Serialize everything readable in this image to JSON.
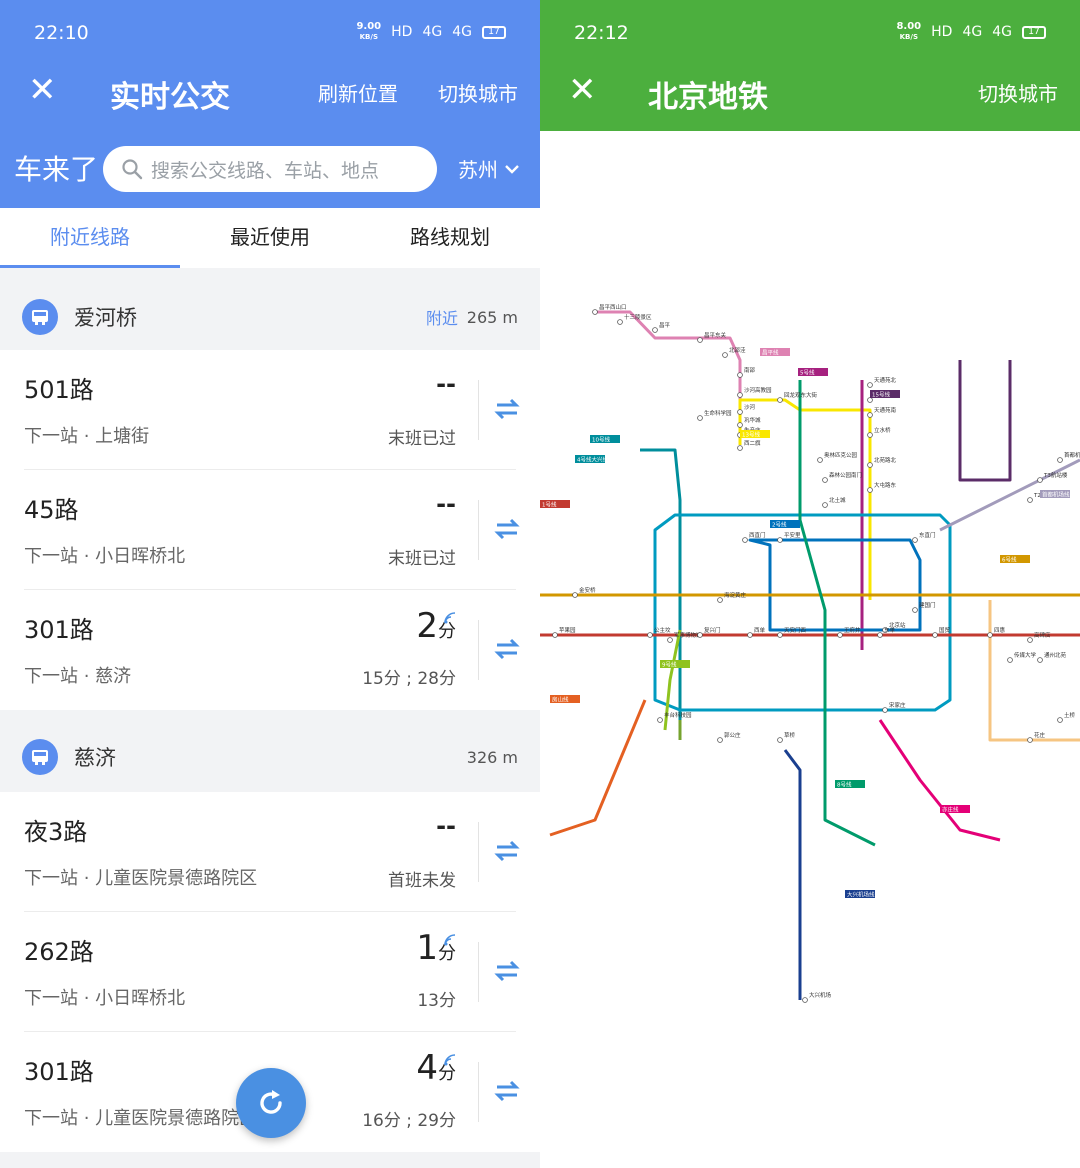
{
  "left": {
    "status": {
      "time": "22:10",
      "speed": "9.00",
      "speed_unit": "KB/S",
      "hd": "HD",
      "net1": "4G",
      "net2": "4G",
      "battery": "17"
    },
    "header": {
      "close_glyph": "✕",
      "title": "实时公交",
      "refresh_label": "刷新位置",
      "switch_city_label": "切换城市",
      "brand": "车来了",
      "search_placeholder": "搜索公交线路、车站、地点",
      "city": "苏州"
    },
    "tabs": [
      {
        "label": "附近线路"
      },
      {
        "label": "最近使用"
      },
      {
        "label": "路线规划"
      }
    ],
    "stops": [
      {
        "name": "爱河桥",
        "near": "附近",
        "distance": "265 m",
        "routes": [
          {
            "line": "501路",
            "next": "下一站 · 上塘街",
            "eta": "--",
            "sub": "末班已过"
          },
          {
            "line": "45路",
            "next": "下一站 · 小日晖桥北",
            "eta": "--",
            "sub": "末班已过"
          },
          {
            "line": "301路",
            "next": "下一站 · 慈济",
            "eta_num": "2",
            "eta_unit": "分",
            "sub": "15分 ; 28分"
          }
        ]
      },
      {
        "name": "慈济",
        "distance": "326 m",
        "routes": [
          {
            "line": "夜3路",
            "next": "下一站 · 儿童医院景德路院区",
            "eta": "--",
            "sub": "首班未发"
          },
          {
            "line": "262路",
            "next": "下一站 · 小日晖桥北",
            "eta_num": "1",
            "eta_unit": "分",
            "sub": "13分"
          },
          {
            "line": "301路",
            "next": "下一站 · 儿童医院景德路院区",
            "eta_num": "4",
            "eta_unit": "分",
            "sub": "16分 ; 29分"
          }
        ]
      }
    ]
  },
  "right": {
    "status": {
      "time": "22:12",
      "speed": "8.00",
      "speed_unit": "KB/S",
      "hd": "HD",
      "net1": "4G",
      "net2": "4G",
      "battery": "17"
    },
    "header": {
      "close_glyph": "✕",
      "title": "北京地铁",
      "switch_city_label": "切换城市"
    },
    "map": {
      "station_labels": [
        "昌平西山口",
        "十三陵景区",
        "昌平",
        "昌平东关",
        "北邵洼",
        "南邵",
        "沙河高教园",
        "沙河",
        "巩华城",
        "朱辛庄",
        "生命科学园",
        "西二旗",
        "回龙观东大街",
        "天通苑北",
        "天通苑",
        "天通苑南",
        "立水桥",
        "北苑路北",
        "大屯路东",
        "奥林匹克公园",
        "森林公园南门",
        "北土城",
        "西直门",
        "海淀黄庄",
        "平安里",
        "东直门",
        "国贸",
        "建国门",
        "北京站",
        "公主坟",
        "军事博物馆",
        "复兴门",
        "西单",
        "天安门西",
        "王府井",
        "东单",
        "四惠",
        "高碑店",
        "传媒大学",
        "通州北苑",
        "土桥",
        "花庄",
        "宋家庄",
        "大兴机场",
        "草桥",
        "丰台科技园",
        "郭公庄",
        "苹果园",
        "金安桥",
        "首都机场",
        "T3航站楼",
        "T2航站楼"
      ],
      "line_labels": [
        "昌平线",
        "13号线",
        "5号线",
        "10号线",
        "4号线大兴线",
        "1号线",
        "2号线",
        "6号线",
        "8号线",
        "9号线",
        "15号线",
        "大兴机场线",
        "亦庄线",
        "房山线",
        "首都机场线"
      ],
      "line_colors": {
        "line1": "#c23a30",
        "line2": "#0072bc",
        "line4": "#008e9c",
        "line5": "#a6217f",
        "line6": "#d29700",
        "line7": "#f6c582",
        "line8": "#009b6b",
        "line9": "#8fc31f",
        "line10": "#009bc0",
        "line13": "#f9e700",
        "line14": "#d5a7a1",
        "line15": "#5b2c68",
        "changping": "#de82b2",
        "daxing_airport": "#1a3f8f",
        "fangshan": "#e46022",
        "yizhuang": "#e40077",
        "airport": "#a29bbb",
        "batong": "#c23a30",
        "line16": "#76a32e"
      }
    }
  }
}
